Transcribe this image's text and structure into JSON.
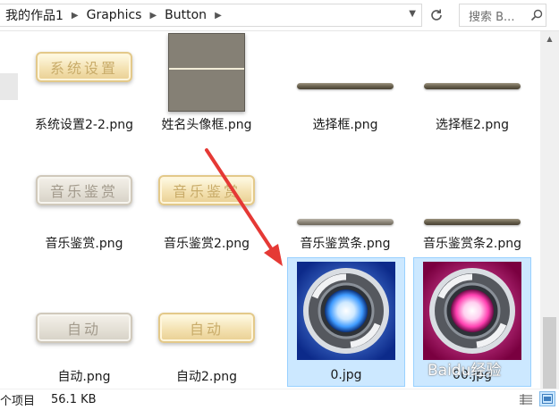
{
  "breadcrumb": [
    "我的作品1",
    "Graphics",
    "Button"
  ],
  "search": {
    "placeholder": "搜索 B..."
  },
  "files": [
    {
      "name": "系统设置2-2.png",
      "thumb": "plaque",
      "thumb_text": "系统设置"
    },
    {
      "name": "姓名头像框.png",
      "thumb": "frame"
    },
    {
      "name": "选择框.png",
      "thumb": "bar"
    },
    {
      "name": "选择框2.png",
      "thumb": "bar"
    },
    {
      "name": "音乐鉴赏.png",
      "thumb": "plaque-gray",
      "thumb_text": "音乐鉴赏"
    },
    {
      "name": "音乐鉴赏2.png",
      "thumb": "plaque",
      "thumb_text": "音乐鉴赏"
    },
    {
      "name": "音乐鉴赏条.png",
      "thumb": "bar-light"
    },
    {
      "name": "音乐鉴赏条2.png",
      "thumb": "bar"
    },
    {
      "name": "自动.png",
      "thumb": "plaque-gray",
      "thumb_text": "自动"
    },
    {
      "name": "自动2.png",
      "thumb": "plaque",
      "thumb_text": "自动"
    },
    {
      "name": "0.jpg",
      "thumb": "orb-blue",
      "selected": true
    },
    {
      "name": "00.jpg",
      "thumb": "orb-pink",
      "selected": true
    }
  ],
  "status": {
    "count": "个项目",
    "size": "56.1 KB"
  },
  "colors": {
    "selection": "#cce8ff",
    "annotation_arrow": "#e53935",
    "orb_blue": "#2f6fe0",
    "orb_pink": "#e0207a"
  },
  "watermark": "Baidu经验"
}
